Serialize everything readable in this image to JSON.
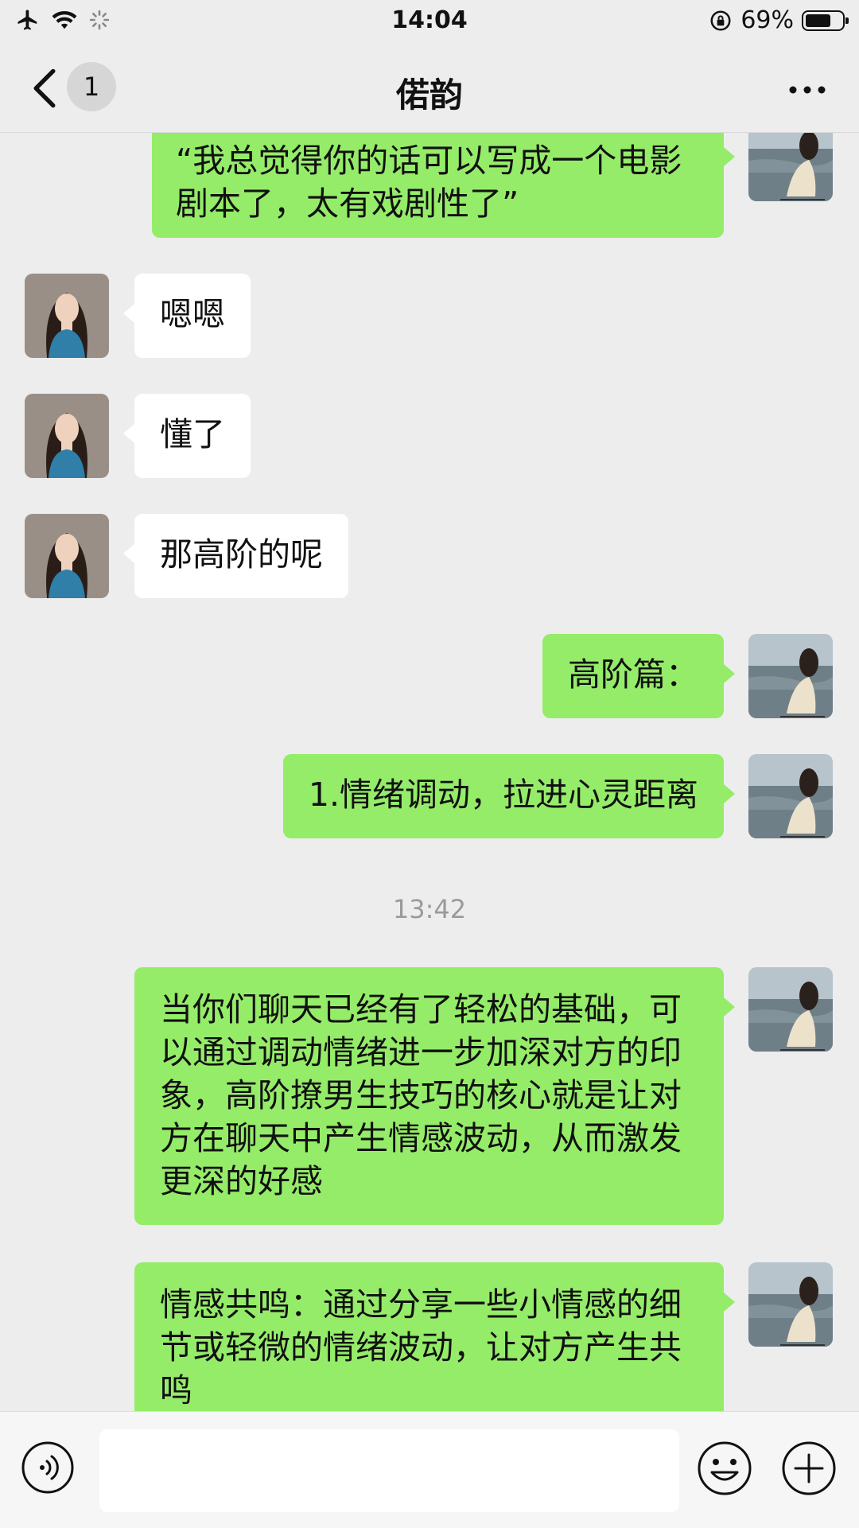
{
  "status_bar": {
    "time": "14:04",
    "battery_percent": "69%",
    "battery_level": 0.69
  },
  "nav": {
    "title": "偌韵",
    "unread_count": "1"
  },
  "chat": {
    "messages": [
      {
        "side": "right",
        "text": "“我总觉得你的话可以写成一个电影剧本了，太有戏剧性了”"
      },
      {
        "side": "left",
        "text": "嗯嗯"
      },
      {
        "side": "left",
        "text": "懂了"
      },
      {
        "side": "left",
        "text": "那高阶的呢"
      },
      {
        "side": "right",
        "text": "高阶篇："
      },
      {
        "side": "right",
        "text": "1.情绪调动，拉进心灵距离"
      },
      {
        "side": "right",
        "text": "当你们聊天已经有了轻松的基础，可以通过调动情绪进一步加深对方的印象，高阶撩男生技巧的核心就是让对方在聊天中产生情感波动，从而激发更深的好感"
      },
      {
        "side": "right",
        "text": "情感共鸣：通过分享一些小情感的细节或轻微的情绪波动，让对方产生共鸣"
      }
    ],
    "timestamp": "13:42"
  },
  "input_bar": {
    "placeholder": ""
  },
  "colors": {
    "background": "#ededed",
    "sent_bubble": "#95ec69",
    "received_bubble": "#ffffff"
  }
}
